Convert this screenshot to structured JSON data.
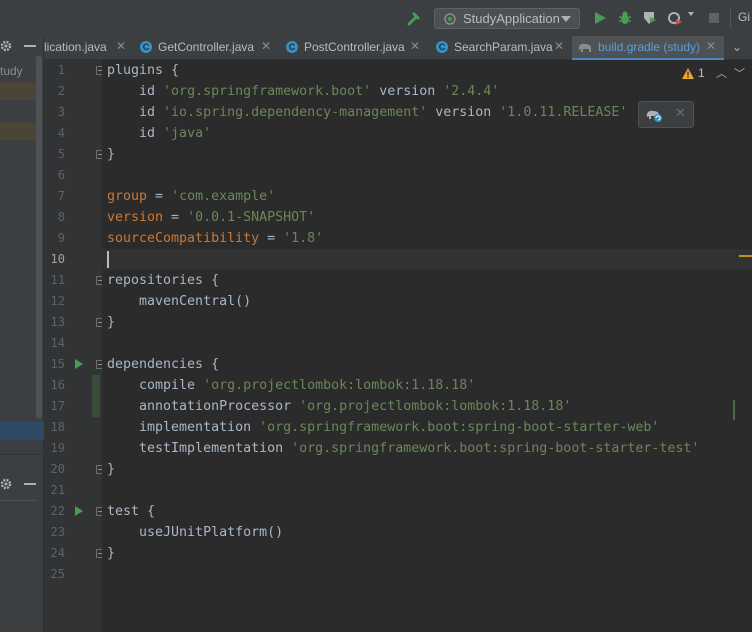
{
  "toolbar": {
    "run_config": "StudyApplication",
    "git_label": "Gi"
  },
  "left_panel": {
    "project_label": "tudy"
  },
  "tabs": [
    {
      "label": "lication.java",
      "icon": "none"
    },
    {
      "label": "GetController.java",
      "icon": "class-icon"
    },
    {
      "label": "PostController.java",
      "icon": "class-icon"
    },
    {
      "label": "SearchParam.java",
      "icon": "class-icon"
    },
    {
      "label": "build.gradle (study)",
      "icon": "gradle-icon",
      "active": true
    }
  ],
  "editor": {
    "warning_count": "1",
    "line_numbers": [
      "1",
      "2",
      "3",
      "4",
      "5",
      "6",
      "7",
      "8",
      "9",
      "10",
      "11",
      "12",
      "13",
      "14",
      "15",
      "16",
      "17",
      "18",
      "19",
      "20",
      "21",
      "22",
      "23",
      "24",
      "25"
    ],
    "current_line": "10",
    "lines": [
      {
        "n": "1",
        "parts": [
          {
            "t": "plugins {",
            "c": ""
          }
        ]
      },
      {
        "n": "2",
        "parts": [
          {
            "t": "    id ",
            "c": ""
          },
          {
            "t": "'org.springframework.boot'",
            "c": "s"
          },
          {
            "t": " version ",
            "c": ""
          },
          {
            "t": "'2.4.4'",
            "c": "s"
          }
        ]
      },
      {
        "n": "3",
        "parts": [
          {
            "t": "    id ",
            "c": ""
          },
          {
            "t": "'io.spring.dependency-management'",
            "c": "s"
          },
          {
            "t": " version ",
            "c": ""
          },
          {
            "t": "'1.0.11.RELEASE'",
            "c": "s"
          }
        ]
      },
      {
        "n": "4",
        "parts": [
          {
            "t": "    id ",
            "c": ""
          },
          {
            "t": "'java'",
            "c": "s"
          }
        ]
      },
      {
        "n": "5",
        "parts": [
          {
            "t": "}",
            "c": ""
          }
        ]
      },
      {
        "n": "6",
        "parts": []
      },
      {
        "n": "7",
        "parts": [
          {
            "t": "group",
            "c": "k"
          },
          {
            "t": " = ",
            "c": ""
          },
          {
            "t": "'com.example'",
            "c": "s"
          }
        ]
      },
      {
        "n": "8",
        "parts": [
          {
            "t": "version",
            "c": "k"
          },
          {
            "t": " = ",
            "c": ""
          },
          {
            "t": "'0.0.1-SNAPSHOT'",
            "c": "s"
          }
        ]
      },
      {
        "n": "9",
        "parts": [
          {
            "t": "sourceCompatibility",
            "c": "k"
          },
          {
            "t": " = ",
            "c": ""
          },
          {
            "t": "'1.8'",
            "c": "s"
          }
        ]
      },
      {
        "n": "10",
        "parts": []
      },
      {
        "n": "11",
        "parts": [
          {
            "t": "repositories {",
            "c": ""
          }
        ]
      },
      {
        "n": "12",
        "parts": [
          {
            "t": "    mavenCentral()",
            "c": ""
          }
        ]
      },
      {
        "n": "13",
        "parts": [
          {
            "t": "}",
            "c": ""
          }
        ]
      },
      {
        "n": "14",
        "parts": []
      },
      {
        "n": "15",
        "parts": [
          {
            "t": "dependencies {",
            "c": ""
          }
        ]
      },
      {
        "n": "16",
        "parts": [
          {
            "t": "    compile ",
            "c": ""
          },
          {
            "t": "'org.projectlombok:lombok:1.18.18'",
            "c": "s"
          }
        ]
      },
      {
        "n": "17",
        "parts": [
          {
            "t": "    annotationProcessor ",
            "c": ""
          },
          {
            "t": "'org.projectlombok:lombok:1.18.18'",
            "c": "s"
          }
        ]
      },
      {
        "n": "18",
        "parts": [
          {
            "t": "    implementation ",
            "c": ""
          },
          {
            "t": "'org.springframework.boot:spring-boot-starter-web'",
            "c": "s"
          }
        ]
      },
      {
        "n": "19",
        "parts": [
          {
            "t": "    testImplementation ",
            "c": ""
          },
          {
            "t": "'org.springframework.boot:spring-boot-starter-test'",
            "c": "s"
          }
        ]
      },
      {
        "n": "20",
        "parts": [
          {
            "t": "}",
            "c": ""
          }
        ]
      },
      {
        "n": "21",
        "parts": []
      },
      {
        "n": "22",
        "parts": [
          {
            "t": "test {",
            "c": ""
          }
        ]
      },
      {
        "n": "23",
        "parts": [
          {
            "t": "    useJUnitPlatform()",
            "c": ""
          }
        ]
      },
      {
        "n": "24",
        "parts": [
          {
            "t": "}",
            "c": ""
          }
        ]
      },
      {
        "n": "25",
        "parts": []
      }
    ]
  },
  "colors": {
    "string": "#6a8759",
    "keyword_like": "#cc7832",
    "text": "#a9b7c6",
    "run_green": "#499c54",
    "accent_blue": "#4a88c7"
  }
}
